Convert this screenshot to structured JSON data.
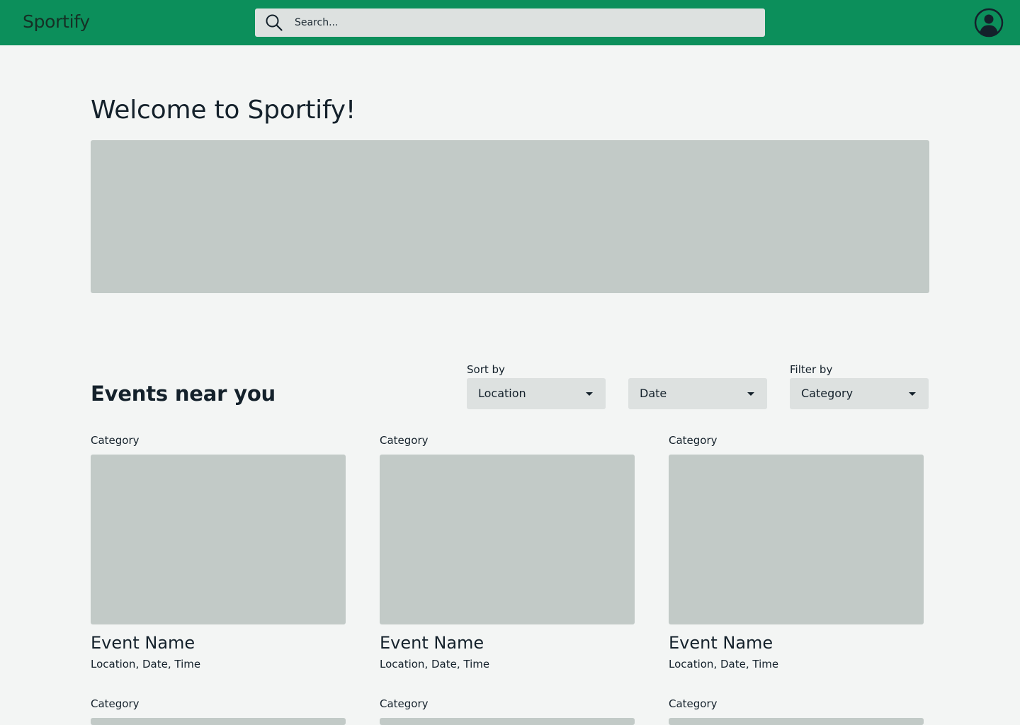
{
  "header": {
    "logo": "Sportify",
    "search_placeholder": "Search..."
  },
  "hero": {
    "title": "Welcome to Sportify!"
  },
  "events_section": {
    "title": "Events near you",
    "sort_label": "Sort by",
    "filter_label": "Filter by",
    "sort_location": "Location",
    "sort_date": "Date",
    "filter_category": "Category"
  },
  "events": [
    {
      "category": "Category",
      "name": "Event Name",
      "meta": "Location, Date, Time"
    },
    {
      "category": "Category",
      "name": "Event Name",
      "meta": "Location, Date, Time"
    },
    {
      "category": "Category",
      "name": "Event Name",
      "meta": "Location, Date, Time"
    },
    {
      "category": "Category"
    },
    {
      "category": "Category"
    },
    {
      "category": "Category"
    }
  ],
  "colors": {
    "header_bg": "#0c8f5b",
    "page_bg": "#f3f5f4",
    "placeholder": "#c2cac7",
    "control_bg": "#dde1e0",
    "text": "#14212b"
  }
}
